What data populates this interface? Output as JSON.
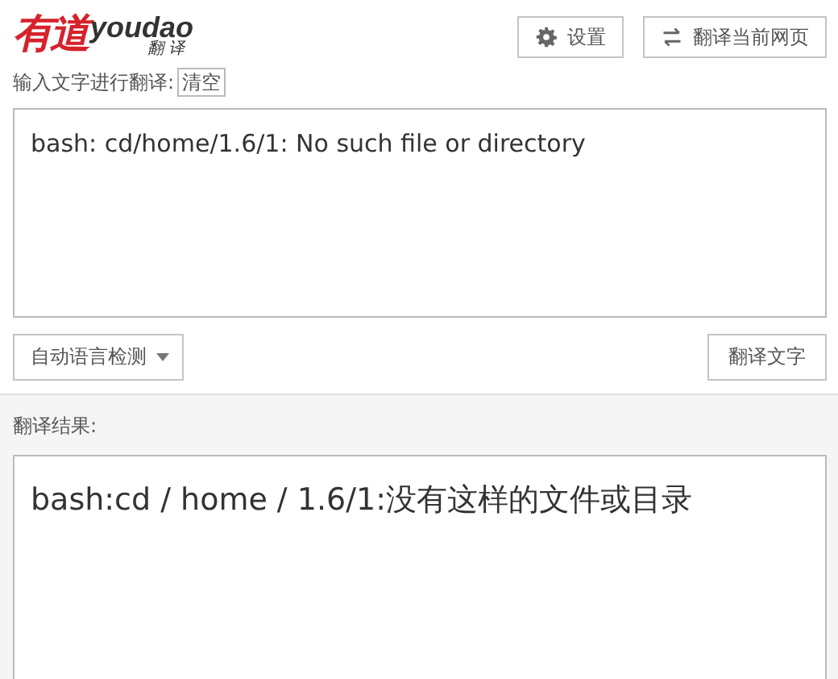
{
  "logo": {
    "mark": "有道",
    "word": "youdao",
    "sub": "翻 译"
  },
  "header_buttons": [
    {
      "kind": "settings",
      "label": "设置"
    },
    {
      "kind": "swap",
      "label": "翻译当前网页"
    }
  ],
  "input": {
    "label": "输入文字进行翻译:",
    "clear_button": "清空",
    "value": "bash: cd/home/1.6/1: No such file or directory"
  },
  "language_dropdown": "自动语言检测",
  "translate_button": "翻译文字",
  "result": {
    "label": "翻译结果:",
    "text": "bash:cd / home / 1.6/1:没有这样的文件或目录"
  }
}
